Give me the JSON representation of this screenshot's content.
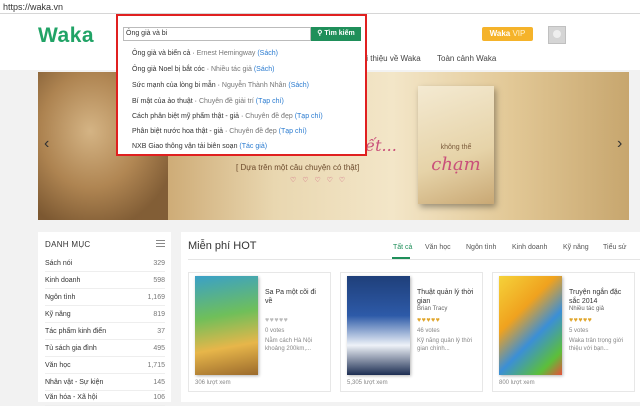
{
  "browser": {
    "url": "https://waka.vn"
  },
  "header": {
    "logo": "Waka",
    "nav": [
      "Giới thiệu về Waka",
      "Toàn cảnh Waka"
    ],
    "vip_waka": "Waka",
    "vip_label": "VIP"
  },
  "search": {
    "value": "Ông già và bi",
    "button": "Tìm kiếm",
    "suggestions": [
      {
        "title": "Ông già và biển cả",
        "meta": "Ernest Hemingway",
        "type": "(Sách)"
      },
      {
        "title": "Ông già Noel bị bắt cóc",
        "meta": "Nhiều tác giả",
        "type": "(Sách)"
      },
      {
        "title": "Sức mạnh của lòng bi mẫn",
        "meta": "Nguyễn Thành Nhân",
        "type": "(Sách)"
      },
      {
        "title": "Bí mật của ảo thuật",
        "meta": "Chuyên đề giải trí",
        "type": "(Tạp chí)"
      },
      {
        "title": "Cách phân biệt mỹ phẩm thật - giả",
        "meta": "Chuyên đề đẹp",
        "type": "(Tạp chí)"
      },
      {
        "title": "Phân biệt nước hoa thật - giả",
        "meta": "Chuyên đề đẹp",
        "type": "(Tạp chí)"
      },
      {
        "title": "NXB Giao thông vận tải biên soạn",
        "meta": "",
        "type": "(Tác giả)"
      }
    ]
  },
  "banner": {
    "script_text": "...ết...",
    "tagline": "[ Dựa trên một câu chuyện có thật]",
    "hearts": "♡ ♡ ♡ ♡ ♡",
    "book_subtitle": "không thể",
    "book_title": "chạm",
    "prev_arrow": "‹",
    "next_arrow": "›"
  },
  "sidebar": {
    "title": "DANH MỤC",
    "items": [
      {
        "label": "Sách nói",
        "count": "329"
      },
      {
        "label": "Kinh doanh",
        "count": "598"
      },
      {
        "label": "Ngôn tình",
        "count": "1,169"
      },
      {
        "label": "Kỹ năng",
        "count": "819"
      },
      {
        "label": "Tác phẩm kinh điển",
        "count": "37"
      },
      {
        "label": "Tủ sách gia đình",
        "count": "495"
      },
      {
        "label": "Văn học",
        "count": "1,715"
      },
      {
        "label": "Nhân vật - Sự kiện",
        "count": "145"
      },
      {
        "label": "Văn hóa - Xã hội",
        "count": "106"
      }
    ]
  },
  "main": {
    "title": "Miễn phí HOT",
    "tabs": [
      "Tất cả",
      "Văn học",
      "Ngôn tình",
      "Kinh doanh",
      "Kỹ năng",
      "Tiểu sử"
    ],
    "cards": [
      {
        "title": "Sa Pa một cõi đi về",
        "author": "",
        "votes": "0 votes",
        "desc": "Nằm cách Hà Nội khoảng 200km,...",
        "reads": "306 lượt xem",
        "stars": "♥♥♥♥♥",
        "rating_level": 0
      },
      {
        "title": "Thuật quản lý thời gian",
        "author": "Brian Tracy",
        "votes": "46 votes",
        "desc": "Kỹ năng quản lý thời gian chính...",
        "reads": "5,305 lượt xem",
        "stars": "♥♥♥♥♥",
        "rating_level": 1
      },
      {
        "title": "Truyện ngắn đặc sắc 2014",
        "author": "Nhiều tác giả",
        "votes": "5 votes",
        "desc": "Waka trân trọng giới thiệu với bạn...",
        "reads": "800 lượt xem",
        "stars": "♥♥♥♥♥",
        "rating_level": 1
      }
    ]
  },
  "colors": {
    "brand": "#21a366",
    "highlight_border": "#e02020",
    "vip": "#f5b32a"
  }
}
